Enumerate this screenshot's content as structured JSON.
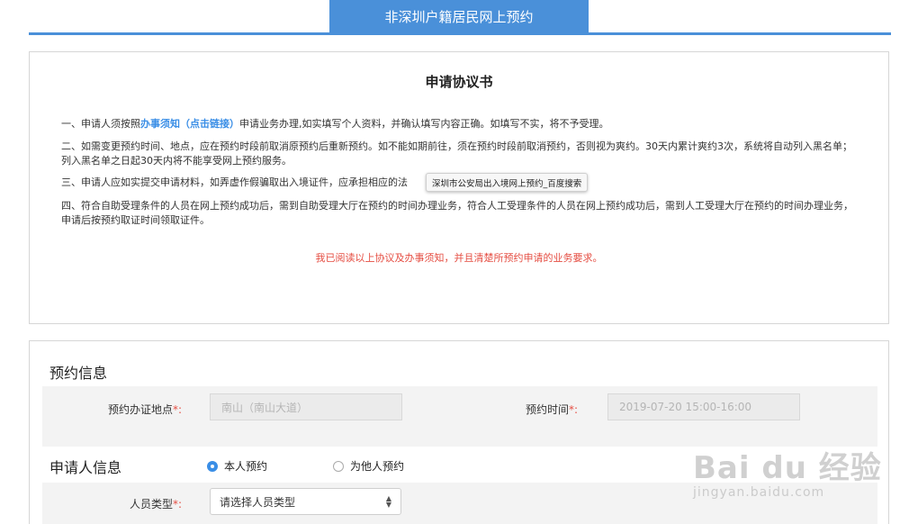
{
  "header": {
    "tab_label": "非深圳户籍居民网上预约"
  },
  "agreement": {
    "title": "申请协议书",
    "clause1_prefix": "一、申请人须按照",
    "clause1_link": "办事须知（点击链接）",
    "clause1_suffix": "申请业务办理,如实填写个人资料，并确认填写内容正确。如填写不实，将不予受理。",
    "clause2": "二、如需变更预约时间、地点，应在预约时段前取消原预约后重新预约。如不能如期前往，须在预约时段前取消预约，否则视为爽约。30天内累计爽约3次，系统将自动列入黑名单；列入黑名单之日起30天内将不能享受网上预约服务。",
    "clause3": "三、申请人应如实提交申请材料，如弄虚作假骗取出入境证件，应承担相应的法",
    "clause4": "四、符合自助受理条件的人员在网上预约成功后，需到自助受理大厅在预约的时间办理业务，符合人工受理条件的人员在网上预约成功后，需到人工受理大厅在预约的时间办理业务，申请后按预约取证时间领取证件。",
    "tooltip": "深圳市公安局出入境网上预约_百度搜索",
    "confirm": "我已阅读以上协议及办事须知，并且清楚所预约申请的业务要求。"
  },
  "booking": {
    "section_title": "预约信息",
    "location_label": "预约办证地点",
    "location_value": "南山（南山大道）",
    "time_label": "预约时间",
    "time_value": "2019-07-20 15:00-16:00",
    "required_mark": "*:"
  },
  "applicant": {
    "section_title": "申请人信息",
    "radio_self": "本人预约",
    "radio_other": "为他人预约",
    "type_label": "人员类型",
    "type_placeholder": "请选择人员类型",
    "required_mark": "*:"
  },
  "watermark": {
    "main": "Bai du 经验",
    "sub": "jingyan.baidu.com"
  },
  "colors": {
    "accent": "#4a90d9",
    "link": "#3a8ee6",
    "warning": "#e54d42"
  }
}
